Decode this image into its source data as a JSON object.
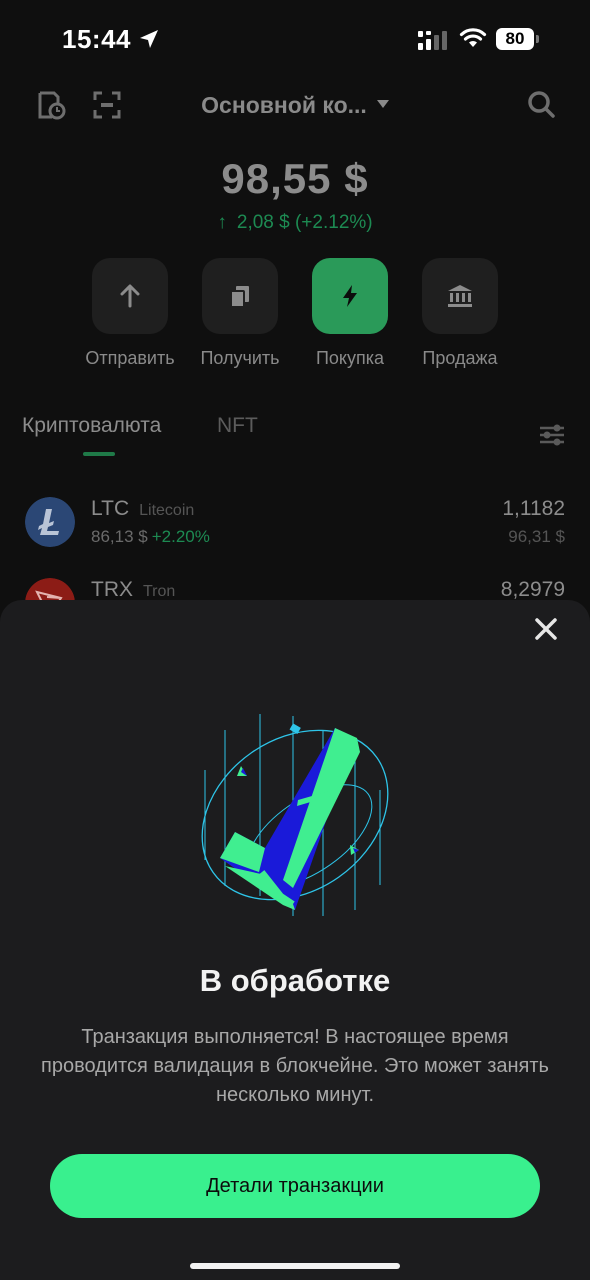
{
  "status_bar": {
    "time": "15:44",
    "battery": "80"
  },
  "header": {
    "wallet_name": "Основной ко..."
  },
  "balance": {
    "total": "98,55 $",
    "change_arrow": "↑",
    "change": "2,08 $ (+2.12%)"
  },
  "actions": [
    {
      "label": "Отправить",
      "icon": "arrow-up-icon"
    },
    {
      "label": "Получить",
      "icon": "copy-icon"
    },
    {
      "label": "Покупка",
      "icon": "lightning-icon"
    },
    {
      "label": "Продажа",
      "icon": "bank-icon"
    }
  ],
  "tabs": {
    "crypto": "Криптовалюта",
    "nft": "NFT"
  },
  "coins": [
    {
      "symbol": "LTC",
      "name": "Litecoin",
      "price": "86,13 $",
      "pct": "+2.20%",
      "amount": "1,1182",
      "value": "96,31 $",
      "color": "#345d9d"
    },
    {
      "symbol": "TRX",
      "name": "Tron",
      "amount": "8,2979",
      "color": "#c0281e"
    }
  ],
  "sheet": {
    "title": "В обработке",
    "message": "Транзакция выполняется! В настоящее время проводится валидация в блокчейне. Это может занять несколько минут.",
    "button": "Детали транзакции"
  },
  "colors": {
    "accent": "#39f08e",
    "positive": "#1d8a52",
    "sheet_bg": "#1c1c1e"
  }
}
